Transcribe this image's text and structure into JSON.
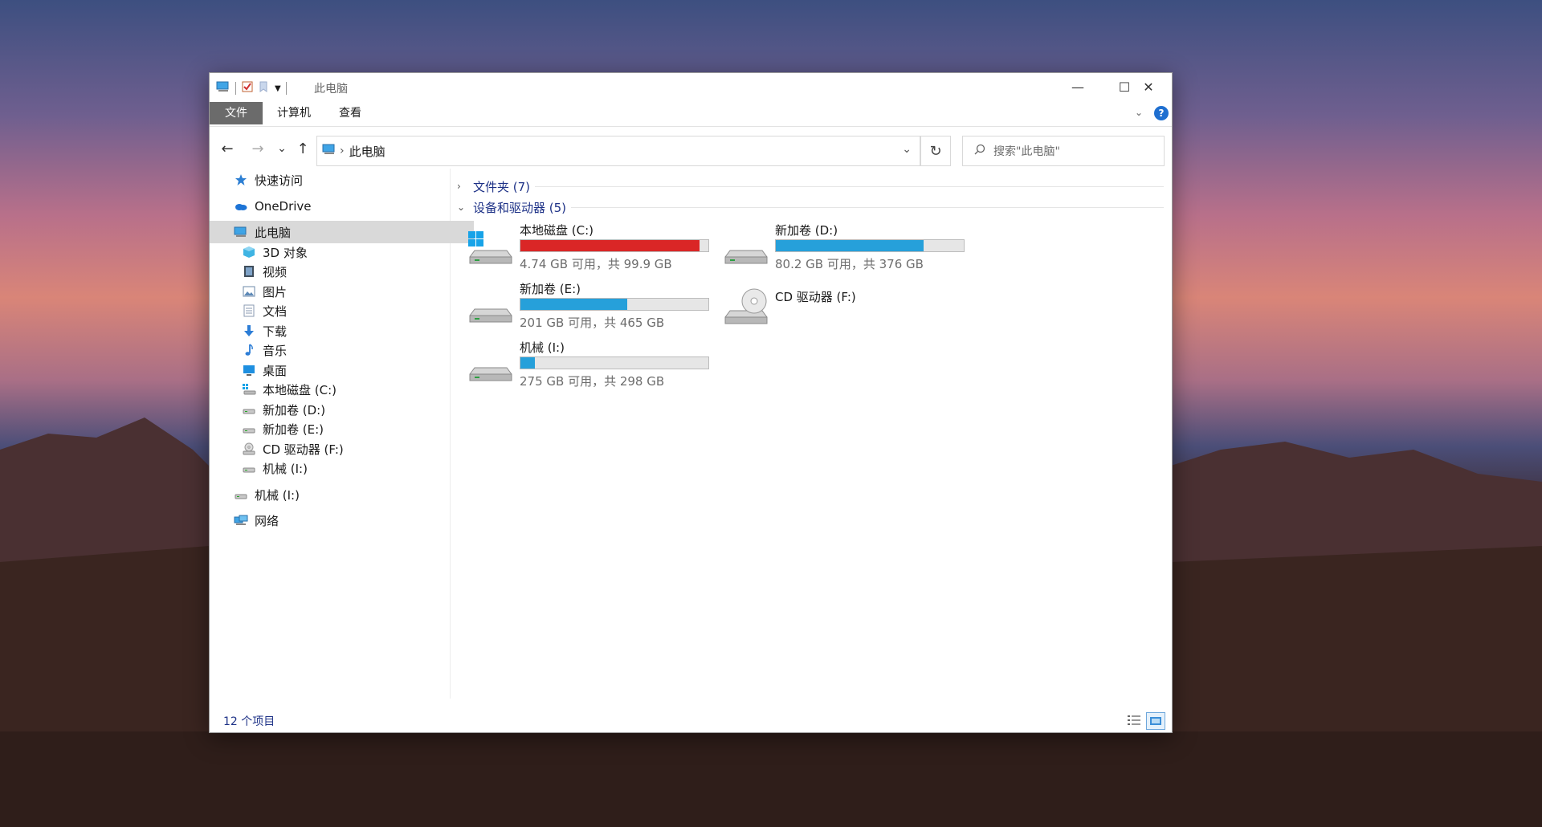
{
  "window": {
    "title": "此电脑",
    "minimize": "—",
    "maximize": "☐",
    "close": "✕"
  },
  "ribbon": {
    "tabs": [
      "文件",
      "计算机",
      "查看"
    ],
    "help": "?"
  },
  "nav": {
    "back": "←",
    "forward": "→",
    "recent": "⌄",
    "up": "↑",
    "breadcrumb_sep": "›",
    "breadcrumb": "此电脑",
    "refresh": "↻",
    "search_placeholder": "搜索\"此电脑\""
  },
  "sidebar": {
    "items": [
      {
        "label": "快速访问",
        "icon": "star-icon"
      },
      {
        "label": "OneDrive",
        "icon": "cloud-icon"
      },
      {
        "label": "此电脑",
        "icon": "pc-icon"
      },
      {
        "label": "3D 对象",
        "icon": "cube-icon"
      },
      {
        "label": "视频",
        "icon": "video-icon"
      },
      {
        "label": "图片",
        "icon": "picture-icon"
      },
      {
        "label": "文档",
        "icon": "document-icon"
      },
      {
        "label": "下载",
        "icon": "download-icon"
      },
      {
        "label": "音乐",
        "icon": "music-icon"
      },
      {
        "label": "桌面",
        "icon": "desktop-icon"
      },
      {
        "label": "本地磁盘 (C:)",
        "icon": "system-drive-icon"
      },
      {
        "label": "新加卷 (D:)",
        "icon": "drive-icon"
      },
      {
        "label": "新加卷 (E:)",
        "icon": "drive-icon"
      },
      {
        "label": "CD 驱动器 (F:)",
        "icon": "cd-drive-icon"
      },
      {
        "label": "机械 (I:)",
        "icon": "drive-icon"
      },
      {
        "label": "机械 (I:)",
        "icon": "drive-icon"
      },
      {
        "label": "网络",
        "icon": "network-icon"
      }
    ]
  },
  "main": {
    "groups": [
      {
        "label": "文件夹 (7)",
        "expanded": false
      },
      {
        "label": "设备和驱动器 (5)",
        "expanded": true
      }
    ],
    "drives": [
      {
        "name": "本地磁盘 (C:)",
        "info": "4.74 GB 可用，共 99.9 GB",
        "used_fraction": 0.953,
        "bar_color": "#da2626",
        "icon": "system-drive-icon"
      },
      {
        "name": "新加卷 (D:)",
        "info": "80.2 GB 可用，共 376 GB",
        "used_fraction": 0.787,
        "bar_color": "#26a0da",
        "icon": "drive-icon"
      },
      {
        "name": "新加卷 (E:)",
        "info": "201 GB 可用，共 465 GB",
        "used_fraction": 0.568,
        "bar_color": "#26a0da",
        "icon": "drive-icon"
      },
      {
        "name": "CD 驱动器 (F:)",
        "info": "",
        "icon": "cd-drive-icon"
      },
      {
        "name": "机械 (I:)",
        "info": "275 GB 可用，共 298 GB",
        "used_fraction": 0.077,
        "bar_color": "#26a0da",
        "icon": "drive-icon"
      }
    ]
  },
  "status": {
    "count": "12 个项目"
  }
}
